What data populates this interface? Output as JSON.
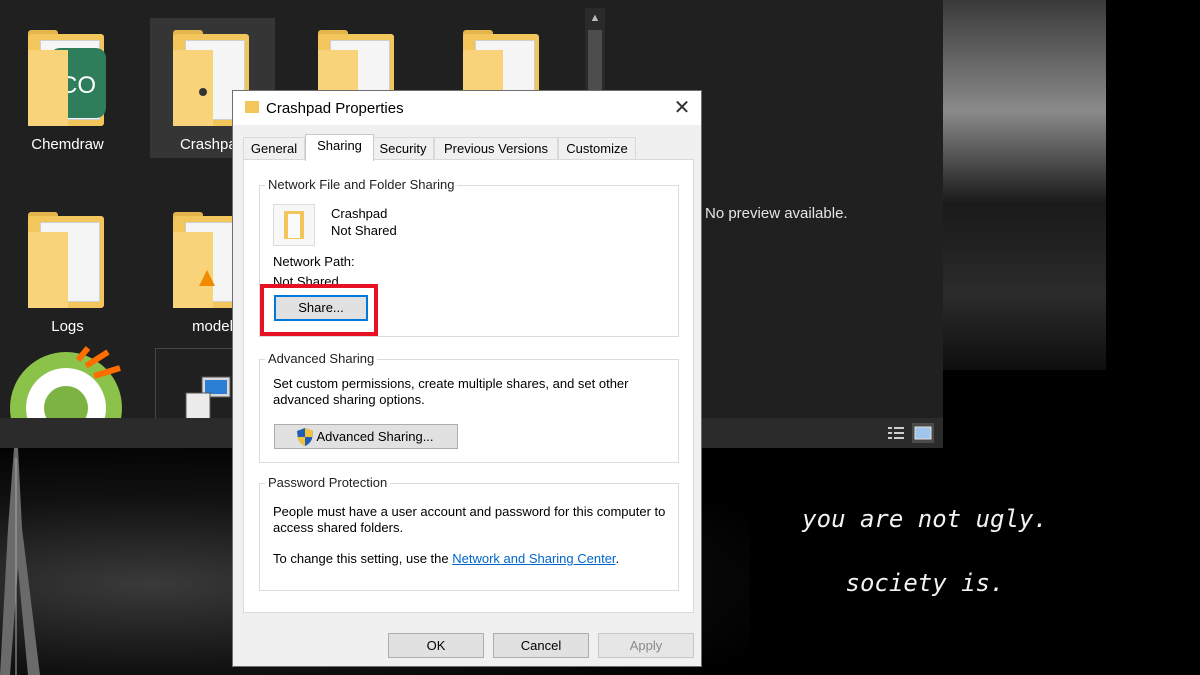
{
  "explorer": {
    "files": [
      {
        "name": "Chemdraw"
      },
      {
        "name": "Crashpad"
      },
      {
        "name": "Logs"
      },
      {
        "name": "model"
      }
    ],
    "preview_text": "No preview available."
  },
  "wallpaper": {
    "quote_line1": "you are not ugly.",
    "quote_line2": "society is."
  },
  "dialog": {
    "title": "Crashpad Properties",
    "tabs": [
      {
        "label": "General"
      },
      {
        "label": "Sharing"
      },
      {
        "label": "Security"
      },
      {
        "label": "Previous Versions"
      },
      {
        "label": "Customize"
      }
    ],
    "active_tab": "Sharing",
    "network_sharing": {
      "title": "Network File and Folder Sharing",
      "folder_name": "Crashpad",
      "folder_status": "Not Shared",
      "path_label": "Network Path:",
      "path_value": "Not Shared",
      "share_button": "Share..."
    },
    "advanced_sharing": {
      "title": "Advanced Sharing",
      "description": "Set custom permissions, create multiple shares, and set other advanced sharing options.",
      "button": "Advanced Sharing..."
    },
    "password_protection": {
      "title": "Password Protection",
      "description": "People must have a user account and password for this computer to access shared folders.",
      "change_prefix": "To change this setting, use the ",
      "link": "Network and Sharing Center",
      "change_suffix": "."
    },
    "buttons": {
      "ok": "OK",
      "cancel": "Cancel",
      "apply": "Apply"
    }
  }
}
